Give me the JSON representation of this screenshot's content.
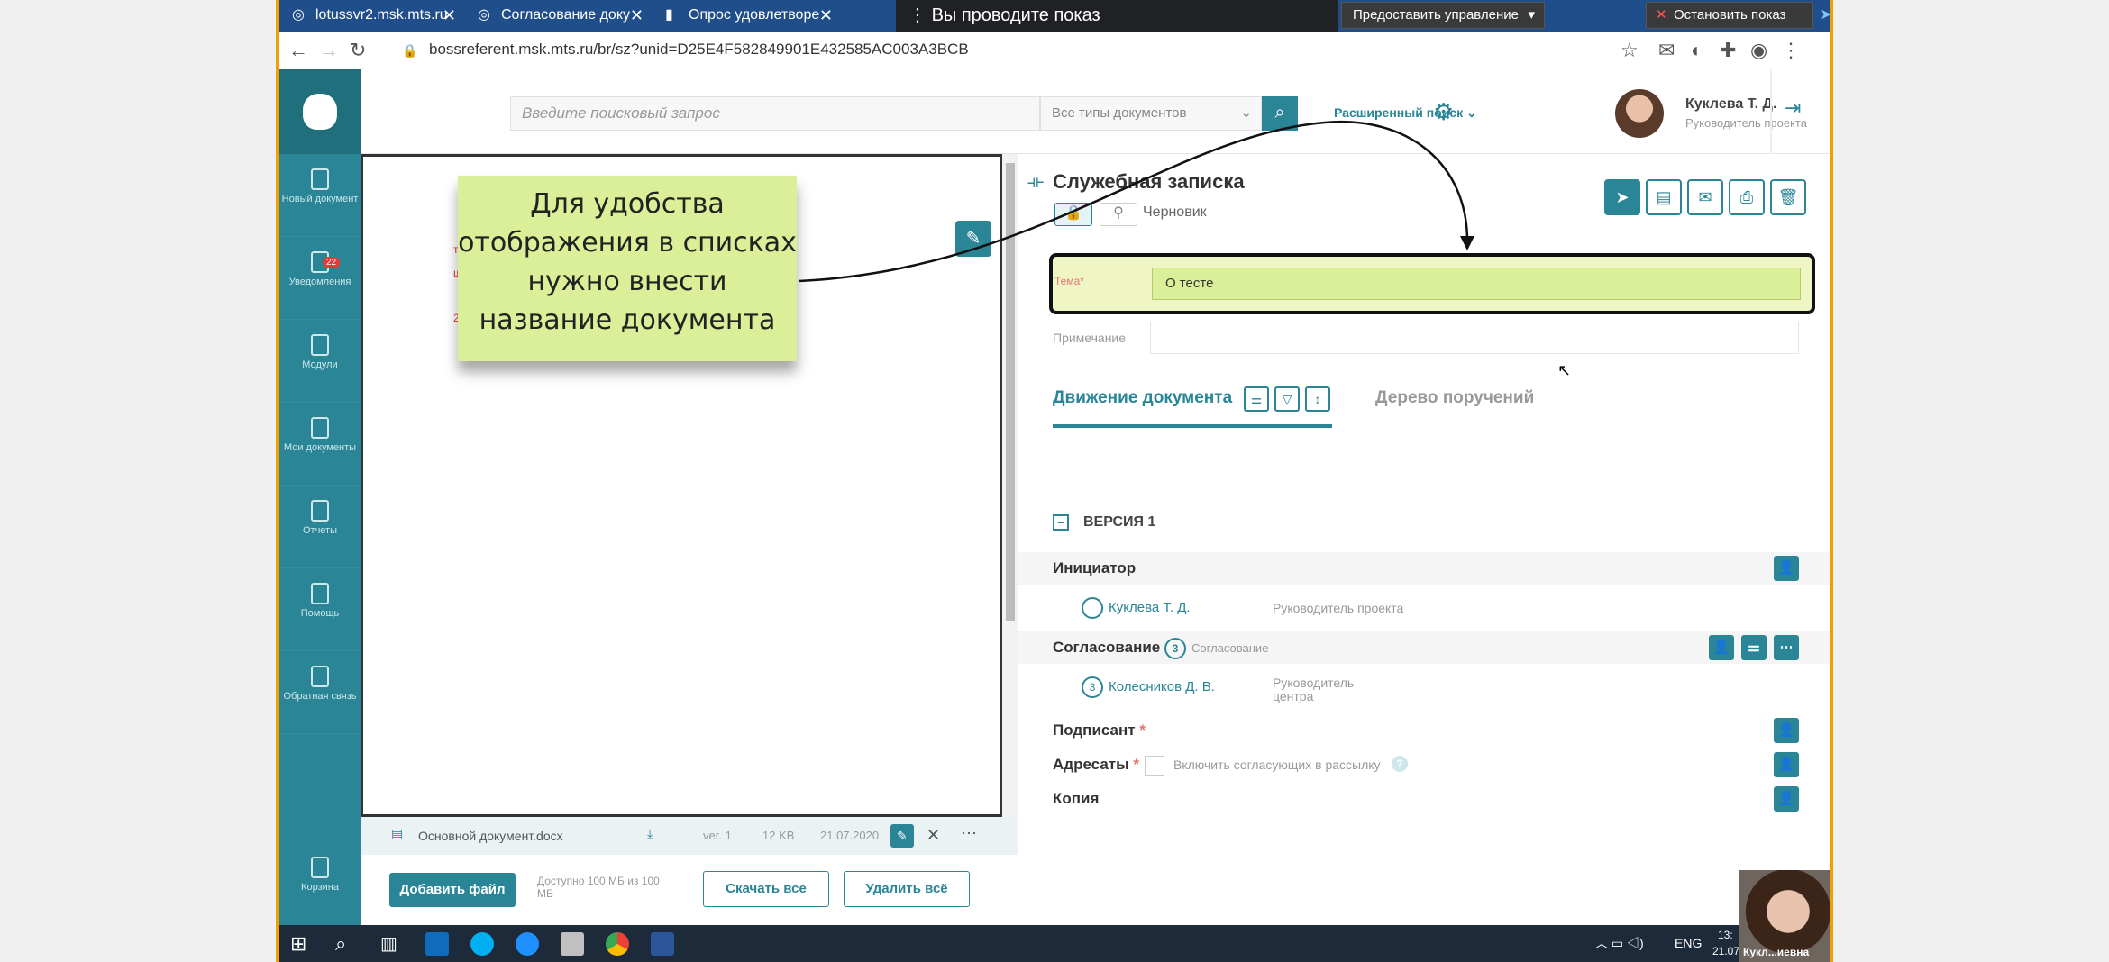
{
  "browser": {
    "tabs": [
      {
        "label": "lotussvr2.msk.mts.ru"
      },
      {
        "label": "Согласование доку"
      },
      {
        "label": "Опрос удовлетворе"
      }
    ],
    "sharing_text": "Вы проводите показ",
    "give_control": "Предоставить управление",
    "stop_show": "Остановить показ",
    "url": "bossreferent.msk.mts.ru/br/sz?unid=D25E4F582849901E432585AC003A3BCB"
  },
  "sidebar": {
    "items": [
      {
        "label": "Новый документ"
      },
      {
        "label": "Уведомления",
        "badge": "22"
      },
      {
        "label": "Модули"
      },
      {
        "label": "Мои документы"
      },
      {
        "label": "Отчеты"
      },
      {
        "label": "Помощь"
      },
      {
        "label": "Обратная связь"
      },
      {
        "label": "Корзина"
      }
    ]
  },
  "topbar": {
    "search_placeholder": "Введите поисковый запрос",
    "doc_type": "Все типы документов",
    "advanced": "Расширенный поиск",
    "user_name": "Куклева Т. Д.",
    "user_role": "Руководитель проекта"
  },
  "sticky_note": "Для удобства отображения в списках нужно внести название документа",
  "file": {
    "name": "Основной документ.docx",
    "version": "ver. 1",
    "size": "12 KB",
    "date": "21.07.2020"
  },
  "bottom": {
    "add_file": "Добавить файл",
    "available": "Доступно 100 МБ из 100 МБ",
    "download_all": "Скачать все",
    "delete_all": "Удалить всё"
  },
  "doc": {
    "title": "Служебная записка",
    "status": "Черновик",
    "tema_label": "Тема*",
    "tema_value": "О тесте",
    "note_label": "Примечание"
  },
  "tabs": {
    "movement": "Движение документа",
    "tree": "Дерево поручений"
  },
  "version": "ВЕРСИЯ 1",
  "sections": {
    "initiator": "Инициатор",
    "initiator_name": "Куклева Т. Д.",
    "initiator_role": "Руководитель проекта",
    "approval": "Согласование",
    "approval_count": "3",
    "approval_sub": "Согласование",
    "approver_name": "Колесников Д. В.",
    "approver_role": "Руководитель центра",
    "signer": "Подписант",
    "addressees": "Адресаты",
    "include_text": "Включить согласующих в рассылку",
    "copy": "Копия"
  },
  "taskbar": {
    "lang": "ENG",
    "time": "13:",
    "date": "21.07",
    "presenter": "Кукл...иевна"
  },
  "colors": {
    "accent": "#2a8596",
    "sticky": "#dbee98",
    "tab_bar": "#1f4e8a"
  }
}
